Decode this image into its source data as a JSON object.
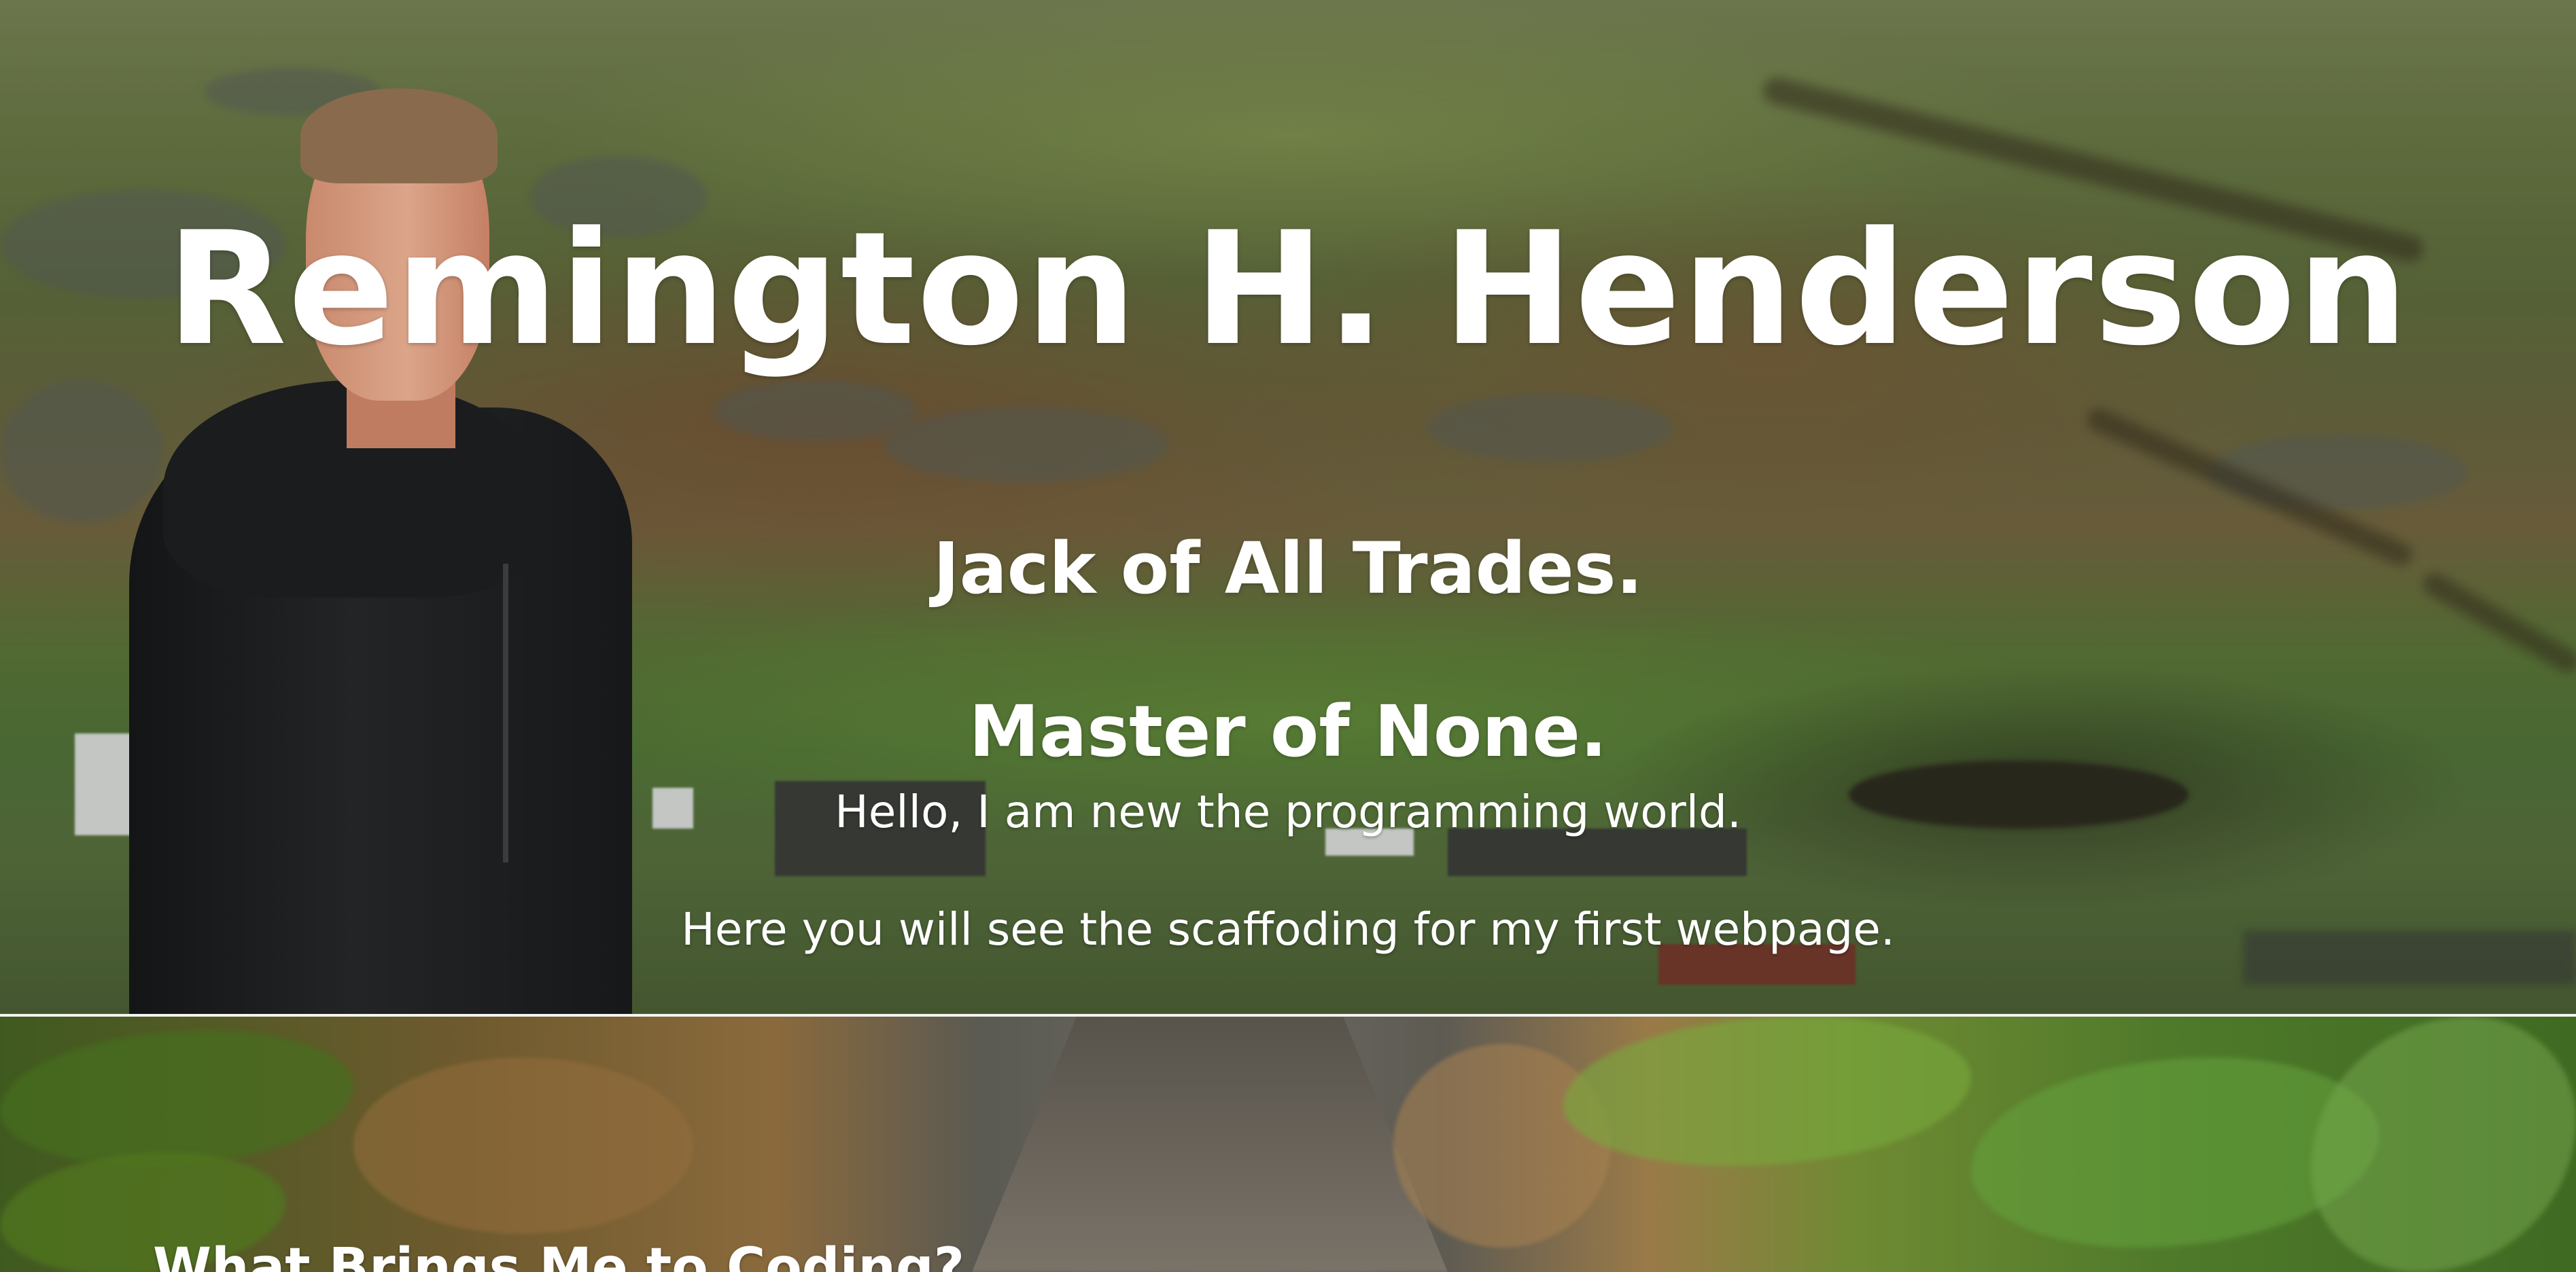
{
  "hero": {
    "name": "Remington H. Henderson",
    "tagline_1": "Jack of All Trades.",
    "tagline_2": "Master of None.",
    "intro_1": "Hello, I am new the programming world.",
    "intro_2": "Here you will see the scaffoding for my first webpage."
  },
  "section": {
    "heading": "What Brings Me to Coding?"
  }
}
